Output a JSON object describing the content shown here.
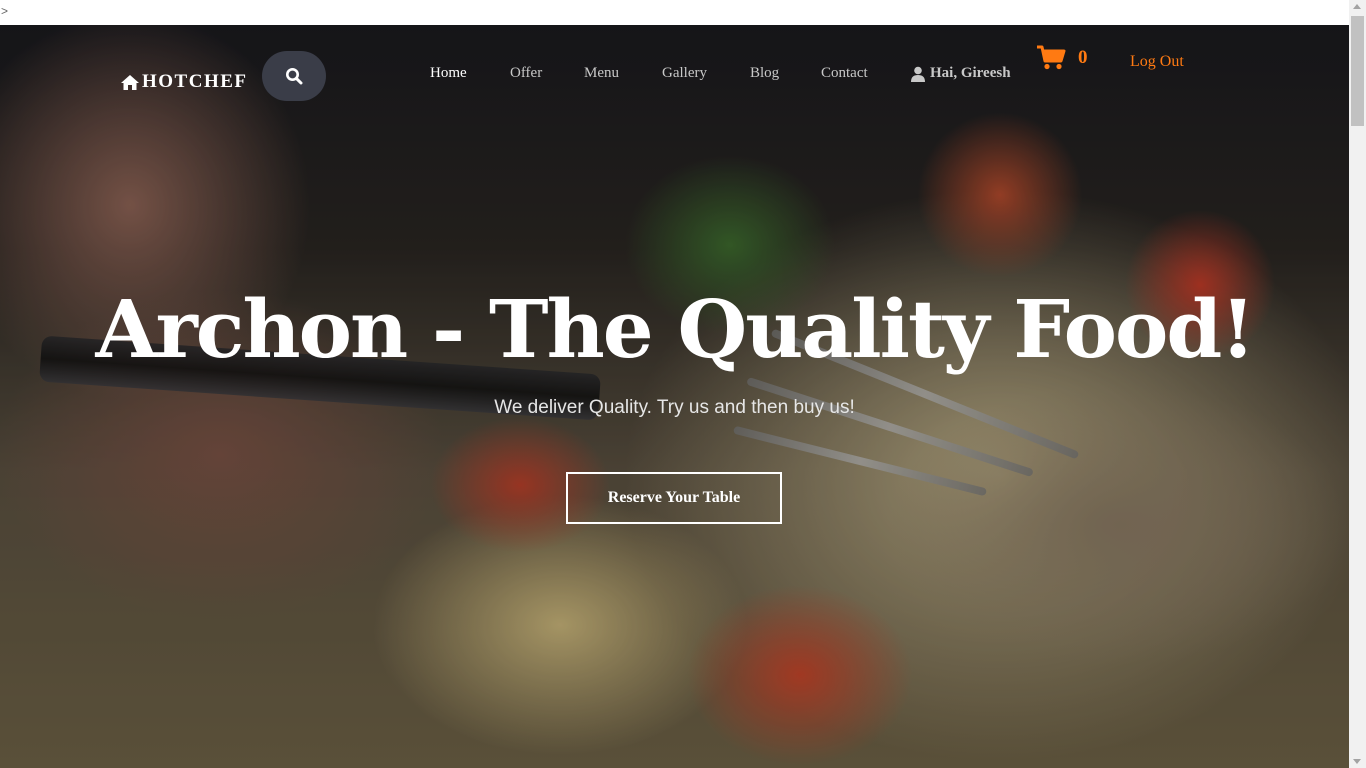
{
  "page": {
    "stray_text": ">"
  },
  "header": {
    "brand": "HOTCHEF",
    "nav": [
      {
        "label": "Home",
        "active": true
      },
      {
        "label": "Offer",
        "active": false
      },
      {
        "label": "Menu",
        "active": false
      },
      {
        "label": "Gallery",
        "active": false
      },
      {
        "label": "Blog",
        "active": false
      },
      {
        "label": "Contact",
        "active": false
      }
    ],
    "user_greeting": "Hai, Gireesh",
    "cart_count": "0",
    "logout_label": "Log Out",
    "accent_color": "#ff7a12"
  },
  "hero": {
    "headline": "Archon - The Quality Food!",
    "tagline": "We deliver Quality. Try us and then buy us!",
    "cta_label": "Reserve Your Table"
  },
  "icons": {
    "brand": "home-icon",
    "search": "search-icon",
    "user": "user-icon",
    "cart": "shopping-cart-icon"
  }
}
